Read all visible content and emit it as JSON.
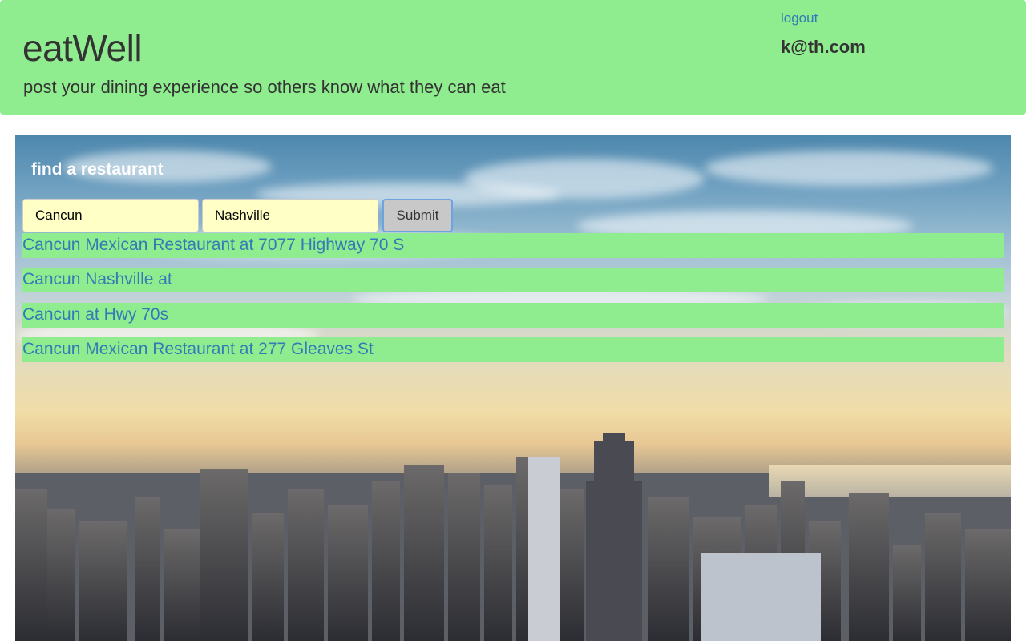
{
  "header": {
    "title": "eatWell",
    "tagline": "post your dining experience so others know what they can eat",
    "logout_label": "logout",
    "user_email": "k@th.com"
  },
  "search": {
    "title": "find a restaurant",
    "name_value": "Cancun",
    "city_value": "Nashville",
    "submit_label": "Submit"
  },
  "results": [
    "Cancun Mexican Restaurant at 7077 Highway 70 S",
    "Cancun Nashville at",
    "Cancun at Hwy 70s",
    "Cancun Mexican Restaurant at 277 Gleaves St"
  ],
  "colors": {
    "header_bg": "#8fed8f",
    "input_bg": "#ffffc6",
    "link": "#337ab7",
    "result_bg": "#8fed8f"
  },
  "background": {
    "image": "city-skyline-sunset-photo"
  }
}
